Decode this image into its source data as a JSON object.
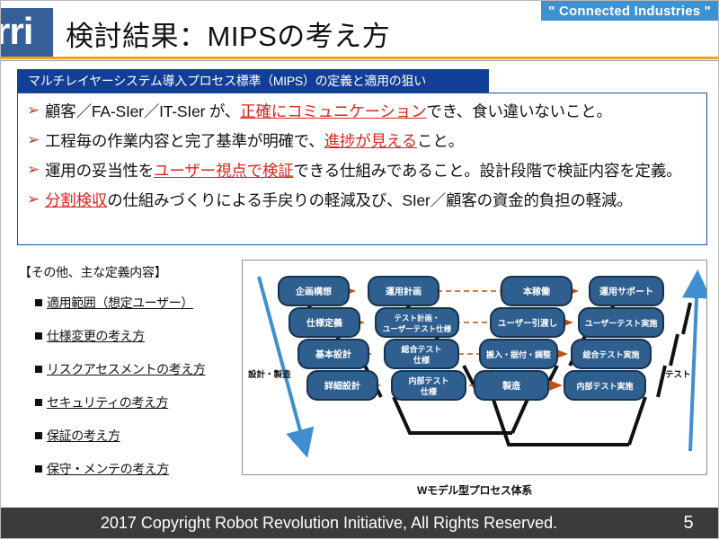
{
  "header": {
    "badge": "\" Connected Industries \"",
    "logo": "rri",
    "title": "検討結果：MIPSの考え方",
    "accent_orange": "#f5a21a",
    "badge_color": "#3b93d4",
    "logo_color": "#345f97"
  },
  "subtitle_bar": {
    "text": "マルチレイヤーシステム導入プロセス標準（MIPS）の定義と適用の狙い",
    "color": "#123e97"
  },
  "bullets": {
    "marker": "➢",
    "items": [
      {
        "parts": [
          {
            "t": "顧客／FA-SIer／IT-SIer が、",
            "u": false
          },
          {
            "t": "正確にコミュニケーション",
            "u": true
          },
          {
            "t": "でき、食い違いないこと。",
            "u": false
          }
        ]
      },
      {
        "parts": [
          {
            "t": "工程毎の作業内容と完了基準が明確で、",
            "u": false
          },
          {
            "t": "進捗が見える",
            "u": true
          },
          {
            "t": "こと。",
            "u": false
          }
        ]
      },
      {
        "parts": [
          {
            "t": "運用の妥当性を",
            "u": false
          },
          {
            "t": "ユーザー視点で検証",
            "u": true
          },
          {
            "t": "できる仕組みであること。設計段階で検証内容を定義。",
            "u": false
          }
        ]
      },
      {
        "parts": [
          {
            "t": "分割検収",
            "u": true
          },
          {
            "t": "の仕組みづくりによる手戻りの軽減及び、SIer／顧客の資金的負担の軽減。",
            "u": false
          }
        ]
      }
    ],
    "underline_color": "#d8261c"
  },
  "other_definitions": {
    "heading": "【その他、主な定義内容】",
    "items": [
      "適用範囲（想定ユーザー）",
      "仕様変更の考え方",
      "リスクアセスメントの考え方",
      "セキュリティの考え方",
      "保証の考え方",
      "保守・メンテの考え方"
    ]
  },
  "diagram": {
    "caption": "Wモデル型プロセス体系",
    "left_axis_label": "設計・製造",
    "right_axis_label": "テスト",
    "box_fill": "#2e5f8f",
    "box_stroke": "#16324f",
    "arrow_color": "#c0500f",
    "axis_arrow_color": "#3f8fd0",
    "connector_color": "#111111",
    "columns": [
      {
        "name": "design",
        "boxes": [
          "企画構想",
          "仕様定義",
          "基本設計",
          "詳細設計"
        ]
      },
      {
        "name": "test-spec",
        "boxes": [
          "テスト計画・ユーザーテスト仕様",
          "総合テスト仕様",
          "内部テスト仕様",
          "運用計画"
        ]
      },
      {
        "name": "build",
        "boxes": [
          "本稼働",
          "ユーザー引渡し",
          "搬入・据付・調整",
          "製造"
        ]
      },
      {
        "name": "test-exec",
        "boxes": [
          "運用サポート",
          "ユーザーテスト実施",
          "総合テスト実施",
          "内部テスト実施"
        ]
      }
    ],
    "rows": [
      {
        "c1": "企画構想",
        "c2": "運用計画",
        "c3": "本稼働",
        "c4": "運用サポート"
      },
      {
        "c1": "仕様定義",
        "c2": "テスト計画・\nユーザーテスト仕様",
        "c3": "ユーザー引渡し",
        "c4": "ユーザーテスト実施"
      },
      {
        "c1": "基本設計",
        "c2": "総合テスト\n仕様",
        "c3": "搬入・据付・調整",
        "c4": "総合テスト実施"
      },
      {
        "c1": "詳細設計",
        "c2": "内部テスト\n仕様",
        "c3": "製造",
        "c4": "内部テスト実施"
      }
    ],
    "row_labels": {
      "r1c2_l1": "運用計画",
      "r2c2_l1": "テスト計画・",
      "r2c2_l2": "ユーザーテスト仕様",
      "r3c2_l1": "総合テスト",
      "r3c2_l2": "仕様",
      "r4c2_l1": "内部テスト",
      "r4c2_l2": "仕様"
    }
  },
  "footer": {
    "copyright": "2017 Copyright Robot Revolution Initiative, All Rights Reserved.",
    "page_number": "5",
    "bg": "#3b3b3b"
  }
}
